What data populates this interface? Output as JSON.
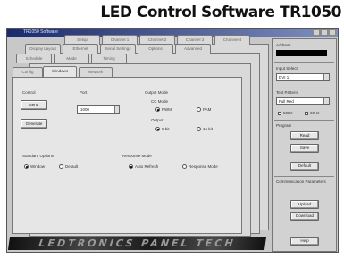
{
  "caption": "LED Control Software TR1050",
  "window": {
    "title": "TR1050 Software"
  },
  "tabs": {
    "row1": [
      "Setup",
      "Channel 1",
      "Channel 2",
      "Channel 3",
      "Channel 4"
    ],
    "row2": [
      "Display Layout",
      "Ethernet",
      "Serial Settings",
      "Options",
      "Advanced"
    ],
    "row3": [
      "Schedule",
      "Mode",
      "Timing"
    ],
    "row4": [
      "Config",
      "Windows",
      "Network"
    ]
  },
  "main": {
    "control_label": "Control",
    "send_button": "Send",
    "generate_button": "Generate",
    "port_label": "Port",
    "port_value": "1000",
    "output_mode_label": "Output Mode",
    "cc_mode_label": "CC Mode",
    "cc_mode_options": [
      "PWM",
      "PAM"
    ],
    "output_label": "Output",
    "output_options": [
      "8 bit",
      "16 bit"
    ],
    "standard_label": "Standard Options",
    "standard_options": [
      "Window",
      "Default"
    ],
    "response_label": "Response Mode",
    "response_options": [
      "Auto Refresh",
      "Response Mode"
    ]
  },
  "right": {
    "address_label": "Address",
    "input_label": "Input Select",
    "input_value": "DVI 1",
    "test_label": "Test Pattern",
    "test_value": "Full Red",
    "test_options": [
      "50Hz",
      "60Hz"
    ],
    "program_label": "Program",
    "read_button": "Read",
    "save_button": "Save",
    "default_button": "Default",
    "comm_label": "Communication Parameters",
    "upload_button": "Upload",
    "download_button": "Download",
    "help_button": "Help"
  },
  "banner": "LEDTRONICS PANEL TECH"
}
